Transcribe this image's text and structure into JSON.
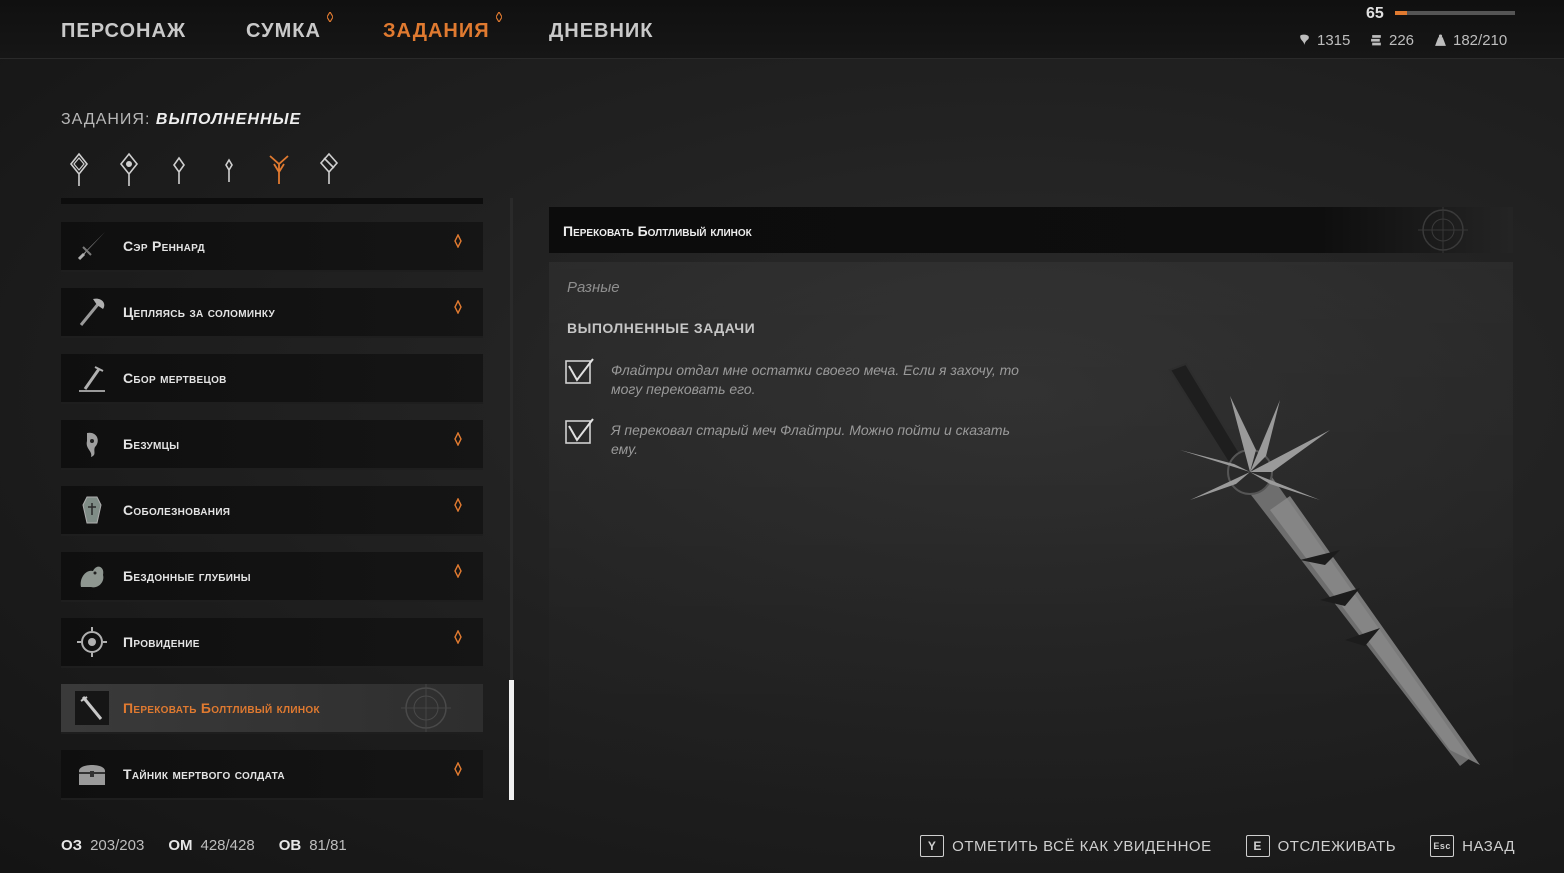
{
  "nav": {
    "tabs": [
      {
        "label": "ПЕРСОНАЖ",
        "active": false,
        "marked": false
      },
      {
        "label": "СУМКА",
        "active": false,
        "marked": true
      },
      {
        "label": "ЗАДАНИЯ",
        "active": true,
        "marked": true
      },
      {
        "label": "ДНЕВНИК",
        "active": false,
        "marked": false
      }
    ]
  },
  "player": {
    "level": "65",
    "xp_fraction": 0.1,
    "stats": [
      {
        "icon": "tooth-icon",
        "value": "1315"
      },
      {
        "icon": "coins-icon",
        "value": "226"
      },
      {
        "icon": "weight-icon",
        "value": "182/210"
      }
    ]
  },
  "quests_header": {
    "prefix": "ЗАДАНИЯ:",
    "filter": "ВЫПОЛНЕННЫЕ"
  },
  "filters": [
    {
      "icon": "quest-filter-all-icon",
      "active": false
    },
    {
      "icon": "quest-filter-main-icon",
      "active": false
    },
    {
      "icon": "quest-filter-side-icon",
      "active": false
    },
    {
      "icon": "quest-filter-small-icon",
      "active": false
    },
    {
      "icon": "quest-filter-completed-icon",
      "active": true
    },
    {
      "icon": "quest-filter-failed-icon",
      "active": false
    }
  ],
  "quests": [
    {
      "label": "Сэр Реннард",
      "icon": "sword-icon",
      "new": true,
      "selected": false
    },
    {
      "label": "Цепляясь за соломинку",
      "icon": "axe-icon",
      "new": true,
      "selected": false
    },
    {
      "label": "Сбор мертвецов",
      "icon": "grave-icon",
      "new": false,
      "selected": false
    },
    {
      "label": "Безумцы",
      "icon": "mask-icon",
      "new": true,
      "selected": false
    },
    {
      "label": "Соболезнования",
      "icon": "coffin-icon",
      "new": true,
      "selected": false
    },
    {
      "label": "Бездонные глубины",
      "icon": "creature-icon",
      "new": true,
      "selected": false
    },
    {
      "label": "Провидение",
      "icon": "eye-icon",
      "new": true,
      "selected": false
    },
    {
      "label": "Перековать Болтливый клинок",
      "icon": "blade-icon",
      "new": false,
      "selected": true
    },
    {
      "label": "Тайник мертвого солдата",
      "icon": "chest-icon",
      "new": true,
      "selected": false
    }
  ],
  "detail": {
    "title": "Перековать Болтливый клинок",
    "category": "Разные",
    "tasks_header": "ВЫПОЛНЕННЫЕ ЗАДАЧИ",
    "tasks": [
      {
        "text": "Флайтри отдал мне остатки своего меча. Если я захочу, то могу перековать его.",
        "done": true
      },
      {
        "text": "Я перековал старый меч Флайтри. Можно пойти и сказать ему.",
        "done": true
      }
    ]
  },
  "footer": {
    "stats": [
      {
        "label": "ОЗ",
        "value": "203/203"
      },
      {
        "label": "ОМ",
        "value": "428/428"
      },
      {
        "label": "ОВ",
        "value": "81/81"
      }
    ],
    "actions": [
      {
        "key": "Y",
        "label": "ОТМЕТИТЬ ВСЁ КАК УВИДЕННОЕ"
      },
      {
        "key": "E",
        "label": "ОТСЛЕЖИВАТЬ"
      },
      {
        "key": "Esc",
        "label": "НАЗАД"
      }
    ]
  },
  "colors": {
    "accent": "#e07a30",
    "text": "#e4e4e4",
    "muted": "#9a9a9a"
  }
}
